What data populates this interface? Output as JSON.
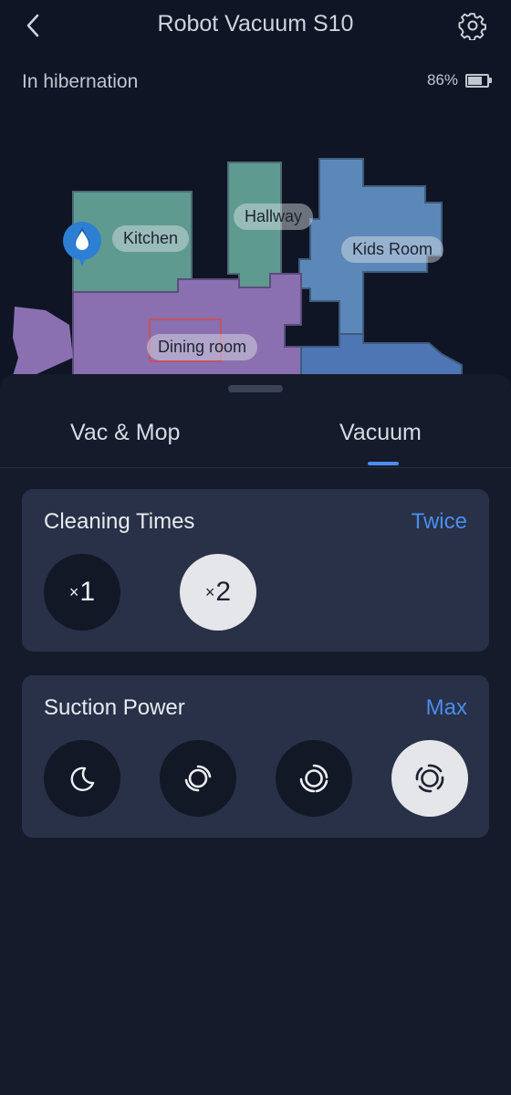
{
  "header": {
    "title": "Robot Vacuum S10",
    "back_icon": "chevron-left-icon",
    "settings_icon": "gear-icon"
  },
  "status": {
    "text": "In hibernation",
    "battery_percent": "86%",
    "battery_level": 0.86
  },
  "map": {
    "rooms": [
      {
        "label": "Kitchen",
        "color": "#5f9a91"
      },
      {
        "label": "Hallway",
        "color": "#5f9a91"
      },
      {
        "label": "Kids Room",
        "color": "#5b88b8"
      },
      {
        "label": "Dining room",
        "color": "#8a70b0"
      }
    ],
    "water_marker_icon": "water-drop-icon"
  },
  "tabs": [
    {
      "label": "Vac & Mop"
    },
    {
      "label": "Vacuum",
      "active": true
    }
  ],
  "cleaning_times": {
    "title": "Cleaning Times",
    "value": "Twice",
    "options": [
      {
        "prefix": "×",
        "label": "1"
      },
      {
        "prefix": "×",
        "label": "2",
        "selected": true
      }
    ]
  },
  "suction_power": {
    "title": "Suction Power",
    "value": "Max",
    "options": [
      {
        "icon": "moon-icon"
      },
      {
        "icon": "suction-standard-icon"
      },
      {
        "icon": "suction-strong-icon"
      },
      {
        "icon": "suction-max-icon",
        "selected": true
      }
    ]
  },
  "colors": {
    "accent": "#4a8df0",
    "background": "#0f1524",
    "card": "#283147"
  }
}
